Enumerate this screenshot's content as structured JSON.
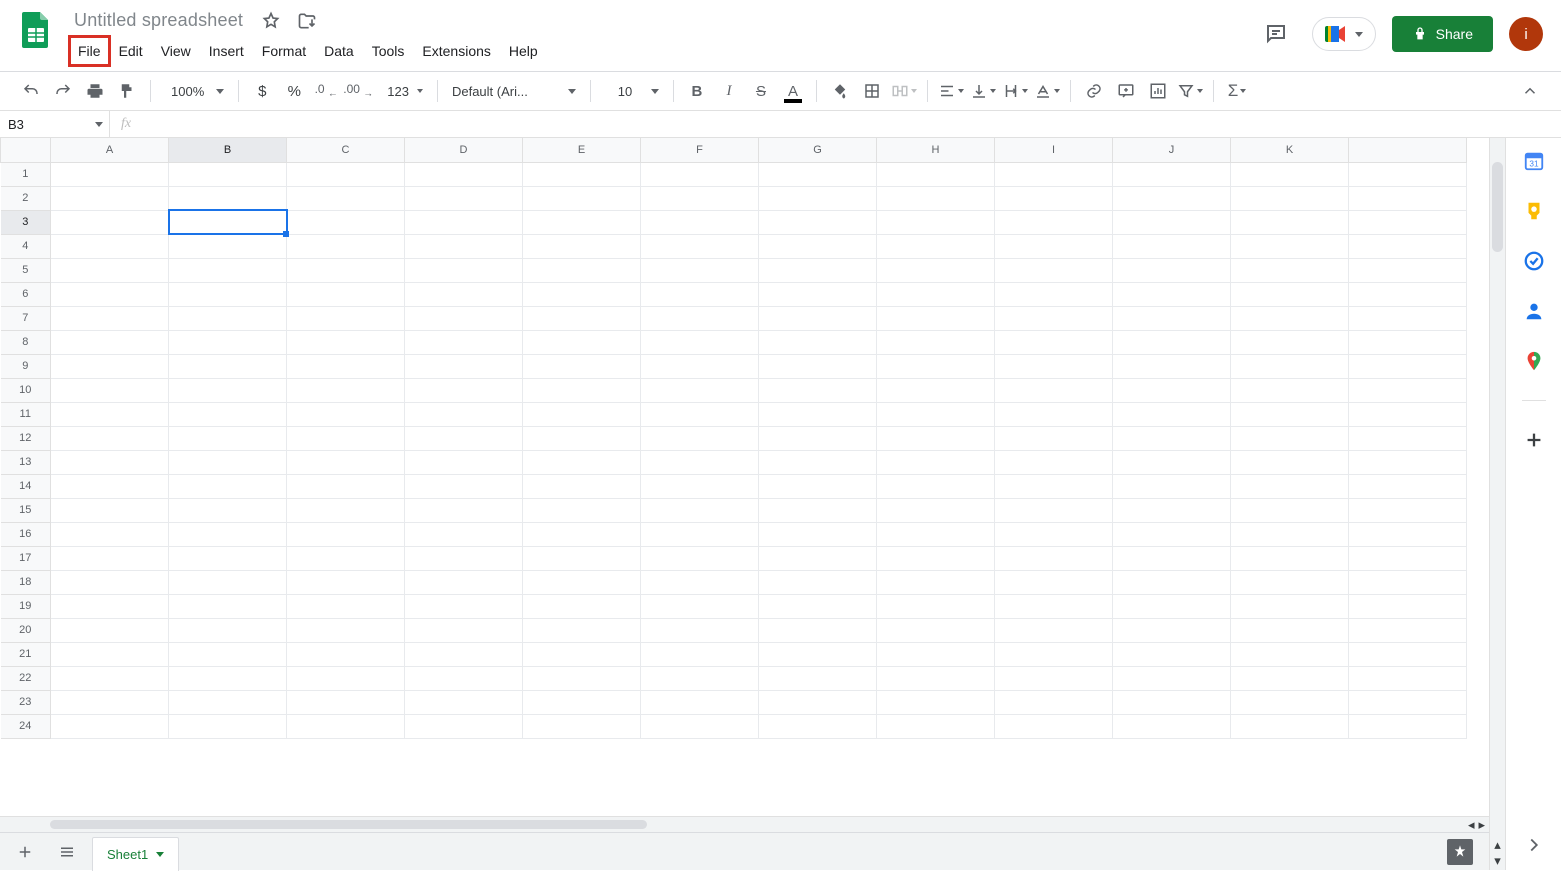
{
  "doc": {
    "title": "Untitled spreadsheet",
    "avatar_letter": "i"
  },
  "menubar": {
    "file": "File",
    "edit": "Edit",
    "view": "View",
    "insert": "Insert",
    "format": "Format",
    "data": "Data",
    "tools": "Tools",
    "extensions": "Extensions",
    "help": "Help"
  },
  "share": {
    "label": "Share"
  },
  "toolbar": {
    "zoom": "100%",
    "currency": "$",
    "percent": "%",
    "dec_decrease": ".0",
    "dec_increase": ".00",
    "numfmt": "123",
    "font": "Default (Ari...",
    "font_size": "10"
  },
  "namebox": {
    "value": "B3"
  },
  "formula": {
    "fx": "fx",
    "value": ""
  },
  "columns": [
    "A",
    "B",
    "C",
    "D",
    "E",
    "F",
    "G",
    "H",
    "I",
    "J",
    "K"
  ],
  "rows": [
    1,
    2,
    3,
    4,
    5,
    6,
    7,
    8,
    9,
    10,
    11,
    12,
    13,
    14,
    15,
    16,
    17,
    18,
    19,
    20,
    21,
    22,
    23,
    24
  ],
  "selected": {
    "col": "B",
    "row": 3
  },
  "tabs": {
    "sheet1": "Sheet1"
  },
  "sidepanel": {
    "calendar_day": "31"
  }
}
